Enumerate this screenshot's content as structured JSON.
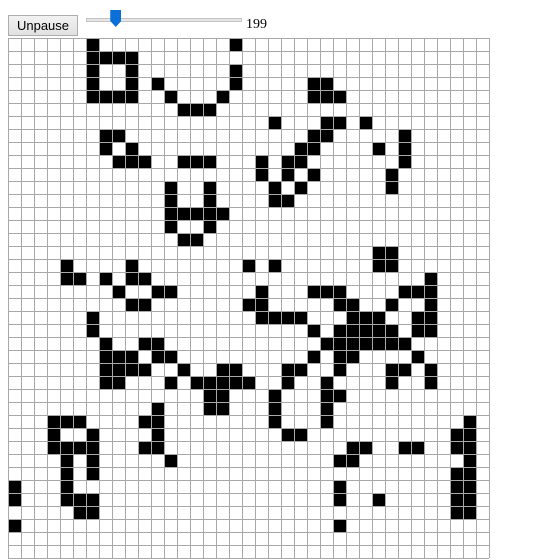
{
  "toolbar": {
    "pause_button_label": "Unpause",
    "slider": {
      "value": 0.19,
      "min": 0,
      "max": 1
    },
    "generation": "199"
  },
  "grid": {
    "columns": 37,
    "rows": 40,
    "live_color": "#000000",
    "dead_color": "#ffffff",
    "line_color": "#a8a8a8",
    "live_cells": [
      [
        0,
        6
      ],
      [
        0,
        17
      ],
      [
        1,
        6
      ],
      [
        1,
        7
      ],
      [
        1,
        8
      ],
      [
        1,
        9
      ],
      [
        2,
        6
      ],
      [
        2,
        9
      ],
      [
        2,
        17
      ],
      [
        3,
        6
      ],
      [
        3,
        9
      ],
      [
        3,
        11
      ],
      [
        3,
        17
      ],
      [
        3,
        23
      ],
      [
        3,
        24
      ],
      [
        4,
        6
      ],
      [
        4,
        7
      ],
      [
        4,
        8
      ],
      [
        4,
        9
      ],
      [
        4,
        12
      ],
      [
        4,
        16
      ],
      [
        4,
        23
      ],
      [
        4,
        24
      ],
      [
        4,
        25
      ],
      [
        5,
        13
      ],
      [
        5,
        14
      ],
      [
        5,
        15
      ],
      [
        6,
        20
      ],
      [
        6,
        24
      ],
      [
        6,
        25
      ],
      [
        6,
        27
      ],
      [
        7,
        7
      ],
      [
        7,
        8
      ],
      [
        7,
        23
      ],
      [
        7,
        24
      ],
      [
        7,
        30
      ],
      [
        8,
        7
      ],
      [
        8,
        9
      ],
      [
        8,
        22
      ],
      [
        8,
        23
      ],
      [
        8,
        28
      ],
      [
        8,
        30
      ],
      [
        9,
        8
      ],
      [
        9,
        9
      ],
      [
        9,
        10
      ],
      [
        9,
        13
      ],
      [
        9,
        14
      ],
      [
        9,
        15
      ],
      [
        9,
        19
      ],
      [
        9,
        21
      ],
      [
        9,
        22
      ],
      [
        9,
        30
      ],
      [
        10,
        19
      ],
      [
        10,
        21
      ],
      [
        10,
        23
      ],
      [
        10,
        29
      ],
      [
        11,
        12
      ],
      [
        11,
        15
      ],
      [
        11,
        20
      ],
      [
        11,
        22
      ],
      [
        11,
        29
      ],
      [
        12,
        12
      ],
      [
        12,
        15
      ],
      [
        12,
        20
      ],
      [
        12,
        21
      ],
      [
        13,
        12
      ],
      [
        13,
        13
      ],
      [
        13,
        14
      ],
      [
        13,
        15
      ],
      [
        13,
        16
      ],
      [
        14,
        12
      ],
      [
        14,
        15
      ],
      [
        15,
        13
      ],
      [
        15,
        14
      ],
      [
        16,
        28
      ],
      [
        16,
        29
      ],
      [
        17,
        4
      ],
      [
        17,
        9
      ],
      [
        17,
        18
      ],
      [
        17,
        20
      ],
      [
        17,
        28
      ],
      [
        17,
        29
      ],
      [
        18,
        4
      ],
      [
        18,
        5
      ],
      [
        18,
        7
      ],
      [
        18,
        9
      ],
      [
        18,
        10
      ],
      [
        18,
        32
      ],
      [
        19,
        8
      ],
      [
        19,
        11
      ],
      [
        19,
        12
      ],
      [
        19,
        19
      ],
      [
        19,
        23
      ],
      [
        19,
        24
      ],
      [
        19,
        25
      ],
      [
        19,
        30
      ],
      [
        19,
        31
      ],
      [
        19,
        32
      ],
      [
        20,
        9
      ],
      [
        20,
        10
      ],
      [
        20,
        18
      ],
      [
        20,
        19
      ],
      [
        20,
        25
      ],
      [
        20,
        26
      ],
      [
        20,
        29
      ],
      [
        20,
        32
      ],
      [
        21,
        6
      ],
      [
        21,
        19
      ],
      [
        21,
        20
      ],
      [
        21,
        21
      ],
      [
        21,
        22
      ],
      [
        21,
        26
      ],
      [
        21,
        27
      ],
      [
        21,
        28
      ],
      [
        21,
        31
      ],
      [
        21,
        32
      ],
      [
        22,
        6
      ],
      [
        22,
        23
      ],
      [
        22,
        25
      ],
      [
        22,
        26
      ],
      [
        22,
        27
      ],
      [
        22,
        28
      ],
      [
        22,
        29
      ],
      [
        22,
        31
      ],
      [
        22,
        32
      ],
      [
        23,
        7
      ],
      [
        23,
        10
      ],
      [
        23,
        11
      ],
      [
        23,
        24
      ],
      [
        23,
        25
      ],
      [
        23,
        26
      ],
      [
        23,
        27
      ],
      [
        23,
        28
      ],
      [
        23,
        29
      ],
      [
        23,
        30
      ],
      [
        24,
        7
      ],
      [
        24,
        8
      ],
      [
        24,
        9
      ],
      [
        24,
        11
      ],
      [
        24,
        12
      ],
      [
        24,
        23
      ],
      [
        24,
        25
      ],
      [
        24,
        26
      ],
      [
        24,
        31
      ],
      [
        25,
        7
      ],
      [
        25,
        8
      ],
      [
        25,
        9
      ],
      [
        25,
        10
      ],
      [
        25,
        13
      ],
      [
        25,
        16
      ],
      [
        25,
        17
      ],
      [
        25,
        21
      ],
      [
        25,
        22
      ],
      [
        25,
        25
      ],
      [
        25,
        29
      ],
      [
        25,
        30
      ],
      [
        25,
        32
      ],
      [
        26,
        7
      ],
      [
        26,
        8
      ],
      [
        26,
        12
      ],
      [
        26,
        14
      ],
      [
        26,
        15
      ],
      [
        26,
        16
      ],
      [
        26,
        17
      ],
      [
        26,
        18
      ],
      [
        26,
        21
      ],
      [
        26,
        24
      ],
      [
        26,
        29
      ],
      [
        26,
        32
      ],
      [
        27,
        15
      ],
      [
        27,
        16
      ],
      [
        27,
        20
      ],
      [
        27,
        24
      ],
      [
        27,
        25
      ],
      [
        28,
        11
      ],
      [
        28,
        15
      ],
      [
        28,
        16
      ],
      [
        28,
        20
      ],
      [
        28,
        24
      ],
      [
        29,
        3
      ],
      [
        29,
        4
      ],
      [
        29,
        5
      ],
      [
        29,
        10
      ],
      [
        29,
        11
      ],
      [
        29,
        20
      ],
      [
        29,
        24
      ],
      [
        29,
        35
      ],
      [
        30,
        3
      ],
      [
        30,
        6
      ],
      [
        30,
        11
      ],
      [
        30,
        21
      ],
      [
        30,
        22
      ],
      [
        30,
        34
      ],
      [
        30,
        35
      ],
      [
        31,
        3
      ],
      [
        31,
        4
      ],
      [
        31,
        5
      ],
      [
        31,
        6
      ],
      [
        31,
        10
      ],
      [
        31,
        11
      ],
      [
        31,
        26
      ],
      [
        31,
        27
      ],
      [
        31,
        30
      ],
      [
        31,
        31
      ],
      [
        31,
        34
      ],
      [
        31,
        35
      ],
      [
        32,
        4
      ],
      [
        32,
        6
      ],
      [
        32,
        12
      ],
      [
        32,
        25
      ],
      [
        32,
        26
      ],
      [
        32,
        35
      ],
      [
        33,
        4
      ],
      [
        33,
        6
      ],
      [
        33,
        34
      ],
      [
        33,
        35
      ],
      [
        34,
        0
      ],
      [
        34,
        4
      ],
      [
        34,
        25
      ],
      [
        34,
        34
      ],
      [
        34,
        35
      ],
      [
        35,
        0
      ],
      [
        35,
        4
      ],
      [
        35,
        5
      ],
      [
        35,
        6
      ],
      [
        35,
        25
      ],
      [
        35,
        28
      ],
      [
        35,
        34
      ],
      [
        35,
        35
      ],
      [
        36,
        5
      ],
      [
        36,
        6
      ],
      [
        36,
        34
      ],
      [
        36,
        35
      ],
      [
        37,
        0
      ],
      [
        37,
        25
      ]
    ]
  }
}
